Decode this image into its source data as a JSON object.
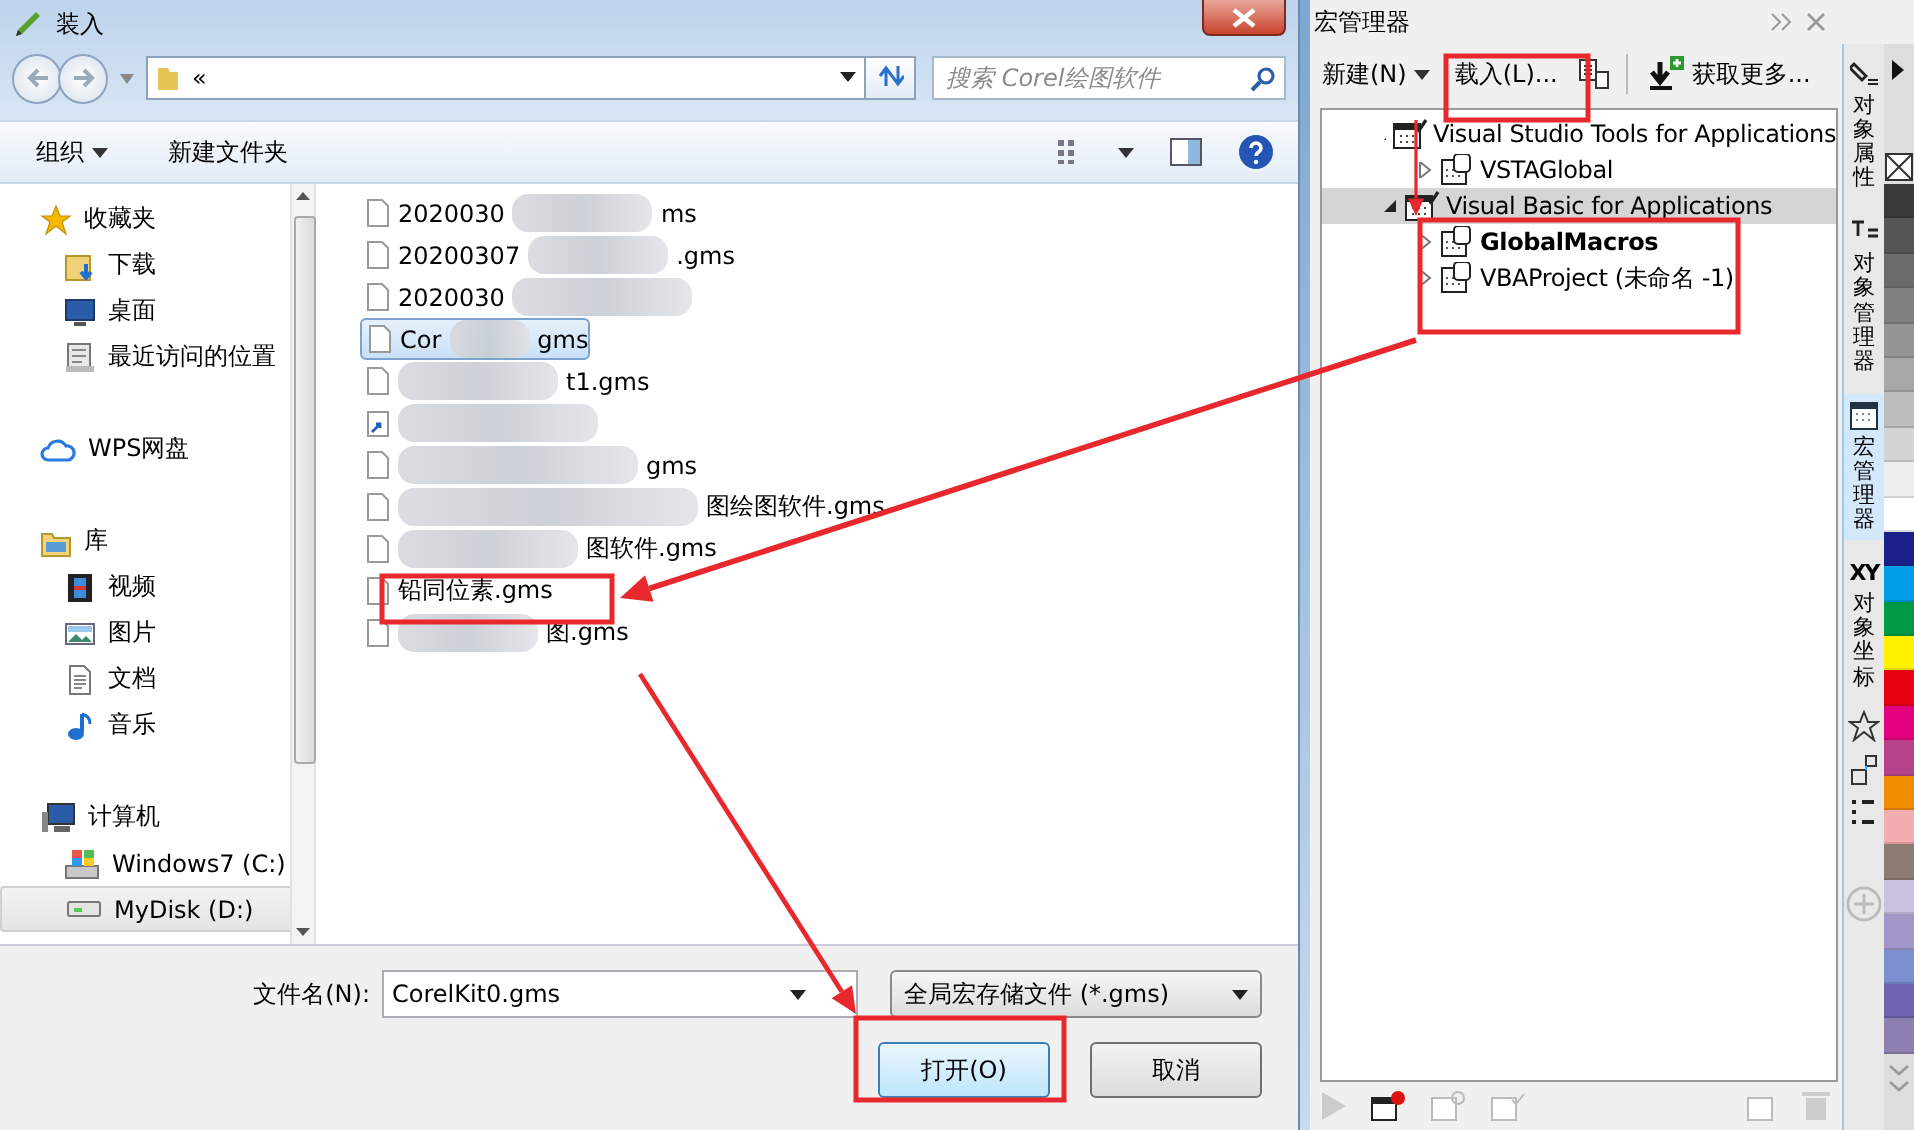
{
  "dialog": {
    "title": "装入",
    "address": "«",
    "search": {
      "placeholder": "搜索 Corel绘图软件"
    },
    "toolbar": [
      {
        "label": "组织",
        "kind": "menu"
      },
      {
        "label": "新建文件夹",
        "kind": "button"
      }
    ],
    "nav": [
      {
        "label": "收藏夹",
        "kind": "star",
        "selected": false,
        "children": [
          {
            "label": "下载",
            "kind": "download",
            "selected": false
          },
          {
            "label": "桌面",
            "kind": "desktop",
            "selected": false
          },
          {
            "label": "最近访问的位置",
            "kind": "recent",
            "selected": false
          }
        ]
      },
      {
        "label": "WPS网盘",
        "kind": "cloud",
        "selected": false
      },
      {
        "label": "库",
        "kind": "library",
        "selected": false,
        "children": [
          {
            "label": "视频",
            "kind": "video",
            "selected": false
          },
          {
            "label": "图片",
            "kind": "image",
            "selected": false
          },
          {
            "label": "文档",
            "kind": "document",
            "selected": false
          },
          {
            "label": "音乐",
            "kind": "music",
            "selected": false
          }
        ]
      },
      {
        "label": "计算机",
        "kind": "computer",
        "selected": false,
        "children": [
          {
            "label": "Windows7 (C:)",
            "kind": "windows-drive",
            "selected": false
          },
          {
            "label": "MyDisk (D:)",
            "kind": "drive",
            "selected": true
          }
        ]
      }
    ],
    "files": [
      {
        "kind": "file",
        "selected": false,
        "parts": [
          {
            "kind": "text",
            "text": "2020030"
          },
          {
            "kind": "blur"
          },
          {
            "kind": "text",
            "text": "ms"
          }
        ]
      },
      {
        "kind": "file",
        "selected": false,
        "parts": [
          {
            "kind": "text",
            "text": "20200307"
          },
          {
            "kind": "blur"
          },
          {
            "kind": "text",
            "text": ".gms"
          }
        ]
      },
      {
        "kind": "file",
        "selected": false,
        "parts": [
          {
            "kind": "text",
            "text": "2020030"
          },
          {
            "kind": "blur"
          }
        ]
      },
      {
        "kind": "file",
        "selected": true,
        "parts": [
          {
            "kind": "text",
            "text": "Cor"
          },
          {
            "kind": "blur"
          },
          {
            "kind": "text",
            "text": "gms"
          }
        ]
      },
      {
        "kind": "file",
        "selected": false,
        "parts": [
          {
            "kind": "blur"
          },
          {
            "kind": "text",
            "text": "t1.gms"
          }
        ]
      },
      {
        "kind": "shortcut",
        "selected": false,
        "parts": [
          {
            "kind": "blur"
          }
        ]
      },
      {
        "kind": "file",
        "selected": false,
        "parts": [
          {
            "kind": "blur"
          },
          {
            "kind": "text",
            "text": "gms"
          }
        ]
      },
      {
        "kind": "file",
        "selected": false,
        "parts": [
          {
            "kind": "blur"
          },
          {
            "kind": "text",
            "text": "图绘图软件.gms"
          }
        ]
      },
      {
        "kind": "file",
        "selected": false,
        "parts": [
          {
            "kind": "blur"
          },
          {
            "kind": "text",
            "text": "图软件.gms"
          }
        ]
      },
      {
        "kind": "file",
        "selected": false,
        "parts": [
          {
            "kind": "text",
            "text": "铅同位素.gms"
          }
        ]
      },
      {
        "kind": "file",
        "selected": false,
        "parts": [
          {
            "kind": "blur"
          },
          {
            "kind": "text",
            "text": "图.gms"
          }
        ]
      }
    ],
    "filename_label": "文件名(N):",
    "filename": "CorelKit0.gms",
    "filetype": "全局宏存储文件 (*.gms)",
    "buttons": [
      {
        "label": "打开(O)",
        "kind": "default"
      },
      {
        "label": "取消",
        "kind": "normal"
      }
    ]
  },
  "macro_manager": {
    "title": "宏管理器",
    "toolbar": [
      {
        "label": "新建(N)",
        "kind": "dropdown"
      },
      {
        "label": "载入(L)...",
        "kind": "button"
      },
      {
        "kind": "icon"
      },
      {
        "label": "获取更多...",
        "kind": "download"
      }
    ],
    "tree": [
      {
        "label": "Visual Studio Tools for Applications",
        "expanded": true,
        "selected": false,
        "bold": false,
        "children": [
          {
            "label": "VSTAGlobal",
            "expanded": false,
            "selected": false,
            "bold": false
          }
        ]
      },
      {
        "label": "Visual Basic for Applications",
        "expanded": true,
        "selected": true,
        "bold": false,
        "children": [
          {
            "label": "GlobalMacros",
            "expanded": false,
            "selected": false,
            "bold": true
          },
          {
            "label": "VBAProject (未命名 -1)",
            "expanded": false,
            "selected": false,
            "bold": false
          }
        ]
      }
    ],
    "side_tabs": [
      {
        "label": "对象属性",
        "selected": false
      },
      {
        "label": "对象管理器",
        "selected": false
      },
      {
        "label": "宏管理器",
        "selected": true
      },
      {
        "label": "对象坐标",
        "glyph": "XY",
        "selected": false
      }
    ],
    "palette": [
      {
        "color": "#3a3a3a"
      },
      {
        "color": "#555555"
      },
      {
        "color": "#6b6b6b"
      },
      {
        "color": "#808080"
      },
      {
        "color": "#959595"
      },
      {
        "color": "#a8a8a8"
      },
      {
        "color": "#bdbdbd"
      },
      {
        "color": "#d4d4d4"
      },
      {
        "color": "#eeeeee"
      },
      {
        "color": "#ffffff"
      },
      {
        "color": "#1b1f8a"
      },
      {
        "color": "#00a0e9"
      },
      {
        "color": "#009944"
      },
      {
        "color": "#fff100"
      },
      {
        "color": "#e60012"
      },
      {
        "color": "#e4007f"
      },
      {
        "color": "#b5428a"
      },
      {
        "color": "#f08c00"
      },
      {
        "color": "#f2aeae"
      },
      {
        "color": "#8b7b72"
      },
      {
        "color": "#c9c3e0"
      },
      {
        "color": "#a397c9"
      },
      {
        "color": "#7b8fcf"
      },
      {
        "color": "#6e63b0"
      },
      {
        "color": "#8d7fb0"
      }
    ]
  }
}
